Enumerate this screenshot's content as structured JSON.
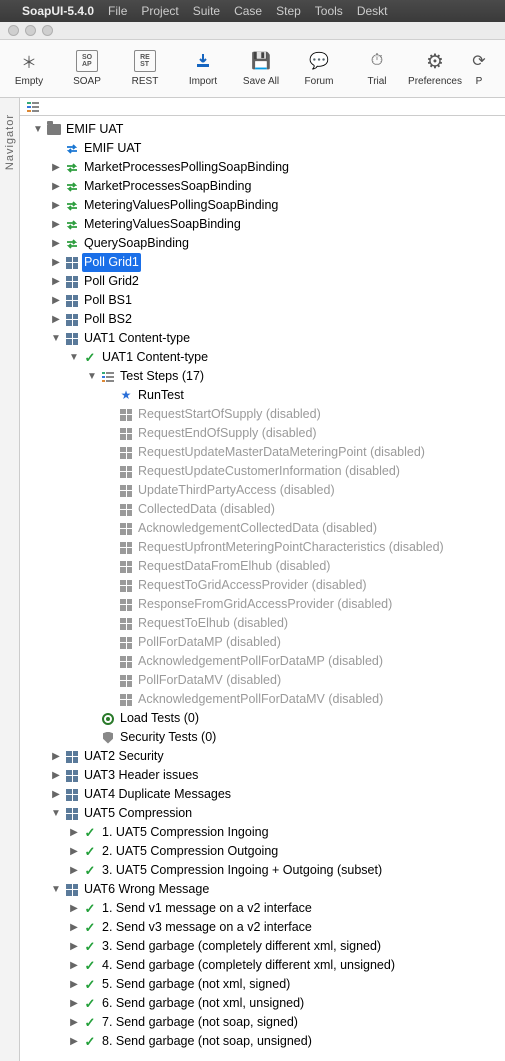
{
  "menubar": {
    "appname": "SoapUI-5.4.0",
    "items": [
      "File",
      "Project",
      "Suite",
      "Case",
      "Step",
      "Tools",
      "Deskt"
    ]
  },
  "toolbar": [
    {
      "id": "empty",
      "label": "Empty",
      "glyph": "＊"
    },
    {
      "id": "soap",
      "label": "SOAP",
      "glyph": "SO\nAP"
    },
    {
      "id": "rest",
      "label": "REST",
      "glyph": "RE\nST"
    },
    {
      "id": "import",
      "label": "Import",
      "glyph": "↓"
    },
    {
      "id": "saveall",
      "label": "Save All",
      "glyph": "💾"
    },
    {
      "id": "forum",
      "label": "Forum",
      "glyph": "💬"
    },
    {
      "id": "trial",
      "label": "Trial",
      "glyph": "⏱"
    },
    {
      "id": "prefs",
      "label": "Preferences",
      "glyph": "⚙"
    },
    {
      "id": "proxy",
      "label": "P",
      "glyph": "⟳"
    }
  ],
  "navigator_label": "Navigator",
  "tree": [
    {
      "d": 0,
      "exp": "down",
      "icon": "folder",
      "label": "EMIF UAT"
    },
    {
      "d": 1,
      "exp": "",
      "icon": "arrows-blue",
      "label": "EMIF UAT"
    },
    {
      "d": 1,
      "exp": "right",
      "icon": "arrows-green",
      "label": "MarketProcessesPollingSoapBinding"
    },
    {
      "d": 1,
      "exp": "right",
      "icon": "arrows-green",
      "label": "MarketProcessesSoapBinding"
    },
    {
      "d": 1,
      "exp": "right",
      "icon": "arrows-green",
      "label": "MeteringValuesPollingSoapBinding"
    },
    {
      "d": 1,
      "exp": "right",
      "icon": "arrows-green",
      "label": "MeteringValuesSoapBinding"
    },
    {
      "d": 1,
      "exp": "right",
      "icon": "arrows-green",
      "label": "QuerySoapBinding"
    },
    {
      "d": 1,
      "exp": "right",
      "icon": "grid4",
      "label": "Poll Grid1",
      "sel": true
    },
    {
      "d": 1,
      "exp": "right",
      "icon": "grid4",
      "label": "Poll Grid2"
    },
    {
      "d": 1,
      "exp": "right",
      "icon": "grid4",
      "label": "Poll BS1"
    },
    {
      "d": 1,
      "exp": "right",
      "icon": "grid4",
      "label": "Poll BS2"
    },
    {
      "d": 1,
      "exp": "down",
      "icon": "grid4",
      "label": "UAT1 Content-type"
    },
    {
      "d": 2,
      "exp": "down",
      "icon": "check",
      "label": "UAT1 Content-type"
    },
    {
      "d": 3,
      "exp": "down",
      "icon": "step3",
      "label": "Test Steps (17)"
    },
    {
      "d": 4,
      "exp": "",
      "icon": "star",
      "label": "RunTest"
    },
    {
      "d": 4,
      "exp": "",
      "icon": "grid4g",
      "label": "RequestStartOfSupply (disabled)",
      "dis": true
    },
    {
      "d": 4,
      "exp": "",
      "icon": "grid4g",
      "label": "RequestEndOfSupply (disabled)",
      "dis": true
    },
    {
      "d": 4,
      "exp": "",
      "icon": "grid4g",
      "label": "RequestUpdateMasterDataMeteringPoint (disabled)",
      "dis": true
    },
    {
      "d": 4,
      "exp": "",
      "icon": "grid4g",
      "label": "RequestUpdateCustomerInformation (disabled)",
      "dis": true
    },
    {
      "d": 4,
      "exp": "",
      "icon": "grid4g",
      "label": "UpdateThirdPartyAccess (disabled)",
      "dis": true
    },
    {
      "d": 4,
      "exp": "",
      "icon": "grid4g",
      "label": "CollectedData (disabled)",
      "dis": true
    },
    {
      "d": 4,
      "exp": "",
      "icon": "grid4g",
      "label": "AcknowledgementCollectedData (disabled)",
      "dis": true
    },
    {
      "d": 4,
      "exp": "",
      "icon": "grid4g",
      "label": "RequestUpfrontMeteringPointCharacteristics (disabled)",
      "dis": true
    },
    {
      "d": 4,
      "exp": "",
      "icon": "grid4g",
      "label": "RequestDataFromElhub (disabled)",
      "dis": true
    },
    {
      "d": 4,
      "exp": "",
      "icon": "grid4g",
      "label": "RequestToGridAccessProvider (disabled)",
      "dis": true
    },
    {
      "d": 4,
      "exp": "",
      "icon": "grid4g",
      "label": "ResponseFromGridAccessProvider (disabled)",
      "dis": true
    },
    {
      "d": 4,
      "exp": "",
      "icon": "grid4g",
      "label": "RequestToElhub (disabled)",
      "dis": true
    },
    {
      "d": 4,
      "exp": "",
      "icon": "grid4g",
      "label": "PollForDataMP (disabled)",
      "dis": true
    },
    {
      "d": 4,
      "exp": "",
      "icon": "grid4g",
      "label": "AcknowledgementPollForDataMP (disabled)",
      "dis": true
    },
    {
      "d": 4,
      "exp": "",
      "icon": "grid4g",
      "label": "PollForDataMV (disabled)",
      "dis": true
    },
    {
      "d": 4,
      "exp": "",
      "icon": "grid4g",
      "label": "AcknowledgementPollForDataMV (disabled)",
      "dis": true
    },
    {
      "d": 3,
      "exp": "",
      "icon": "bullseye",
      "label": "Load Tests (0)"
    },
    {
      "d": 3,
      "exp": "",
      "icon": "shield",
      "label": "Security Tests (0)"
    },
    {
      "d": 1,
      "exp": "right",
      "icon": "grid4",
      "label": "UAT2 Security"
    },
    {
      "d": 1,
      "exp": "right",
      "icon": "grid4",
      "label": "UAT3 Header issues"
    },
    {
      "d": 1,
      "exp": "right",
      "icon": "grid4",
      "label": "UAT4 Duplicate Messages"
    },
    {
      "d": 1,
      "exp": "down",
      "icon": "grid4",
      "label": "UAT5 Compression"
    },
    {
      "d": 2,
      "exp": "right",
      "icon": "check",
      "label": "1. UAT5 Compression Ingoing"
    },
    {
      "d": 2,
      "exp": "right",
      "icon": "check",
      "label": "2. UAT5 Compression Outgoing"
    },
    {
      "d": 2,
      "exp": "right",
      "icon": "check",
      "label": "3. UAT5 Compression Ingoing + Outgoing (subset)"
    },
    {
      "d": 1,
      "exp": "down",
      "icon": "grid4",
      "label": "UAT6 Wrong Message"
    },
    {
      "d": 2,
      "exp": "right",
      "icon": "check",
      "label": "1. Send v1 message on a v2 interface"
    },
    {
      "d": 2,
      "exp": "right",
      "icon": "check",
      "label": "2. Send v3 message on a v2 interface"
    },
    {
      "d": 2,
      "exp": "right",
      "icon": "check",
      "label": "3. Send garbage (completely different xml, signed)"
    },
    {
      "d": 2,
      "exp": "right",
      "icon": "check",
      "label": "4. Send garbage (completely different xml, unsigned)"
    },
    {
      "d": 2,
      "exp": "right",
      "icon": "check",
      "label": "5. Send garbage (not xml, signed)"
    },
    {
      "d": 2,
      "exp": "right",
      "icon": "check",
      "label": "6. Send garbage (not xml, unsigned)"
    },
    {
      "d": 2,
      "exp": "right",
      "icon": "check",
      "label": "7. Send garbage (not soap, signed)"
    },
    {
      "d": 2,
      "exp": "right",
      "icon": "check",
      "label": "8. Send garbage (not soap, unsigned)"
    }
  ]
}
